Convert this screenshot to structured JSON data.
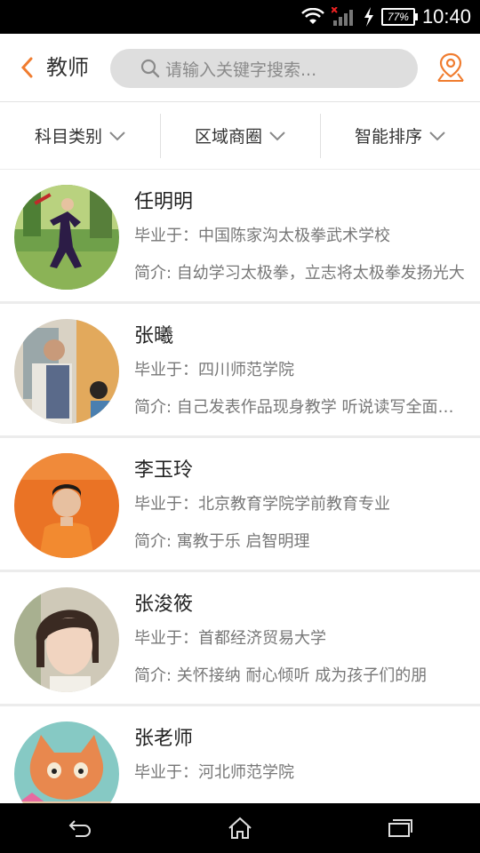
{
  "status_bar": {
    "time": "10:40",
    "battery": "77%",
    "icons": [
      "wifi-icon",
      "signal-icon",
      "charging-icon"
    ]
  },
  "header": {
    "back_icon": "chevron-left-icon",
    "title": "教师",
    "search_placeholder": "请输入关键字搜索...",
    "location_icon": "location-pin-icon"
  },
  "filters": [
    {
      "label": "科目类别"
    },
    {
      "label": "区域商圈"
    },
    {
      "label": "智能排序"
    }
  ],
  "teachers": [
    {
      "name": "任明明",
      "school": "毕业于：中国陈家沟太极拳武术学校",
      "intro": "简介: 自幼学习太极拳，立志将太极拳发扬光大"
    },
    {
      "name": "张曦",
      "school": "毕业于：四川师范学院",
      "intro": "简介: 自己发表作品现身教学 听说读写全面提升"
    },
    {
      "name": "李玉玲",
      "school": "毕业于：北京教育学院学前教育专业",
      "intro": "简介: 寓教于乐  启智明理"
    },
    {
      "name": "张浚筱",
      "school": "毕业于：首都经济贸易大学",
      "intro": "简介: 关怀接纳  耐心倾听  成为孩子们的朋"
    },
    {
      "name": "张老师",
      "school": "毕业于：河北师范学院",
      "intro": ""
    }
  ],
  "nav": [
    "back-icon",
    "home-icon",
    "recents-icon"
  ],
  "colors": {
    "accent": "#f07c2f"
  }
}
